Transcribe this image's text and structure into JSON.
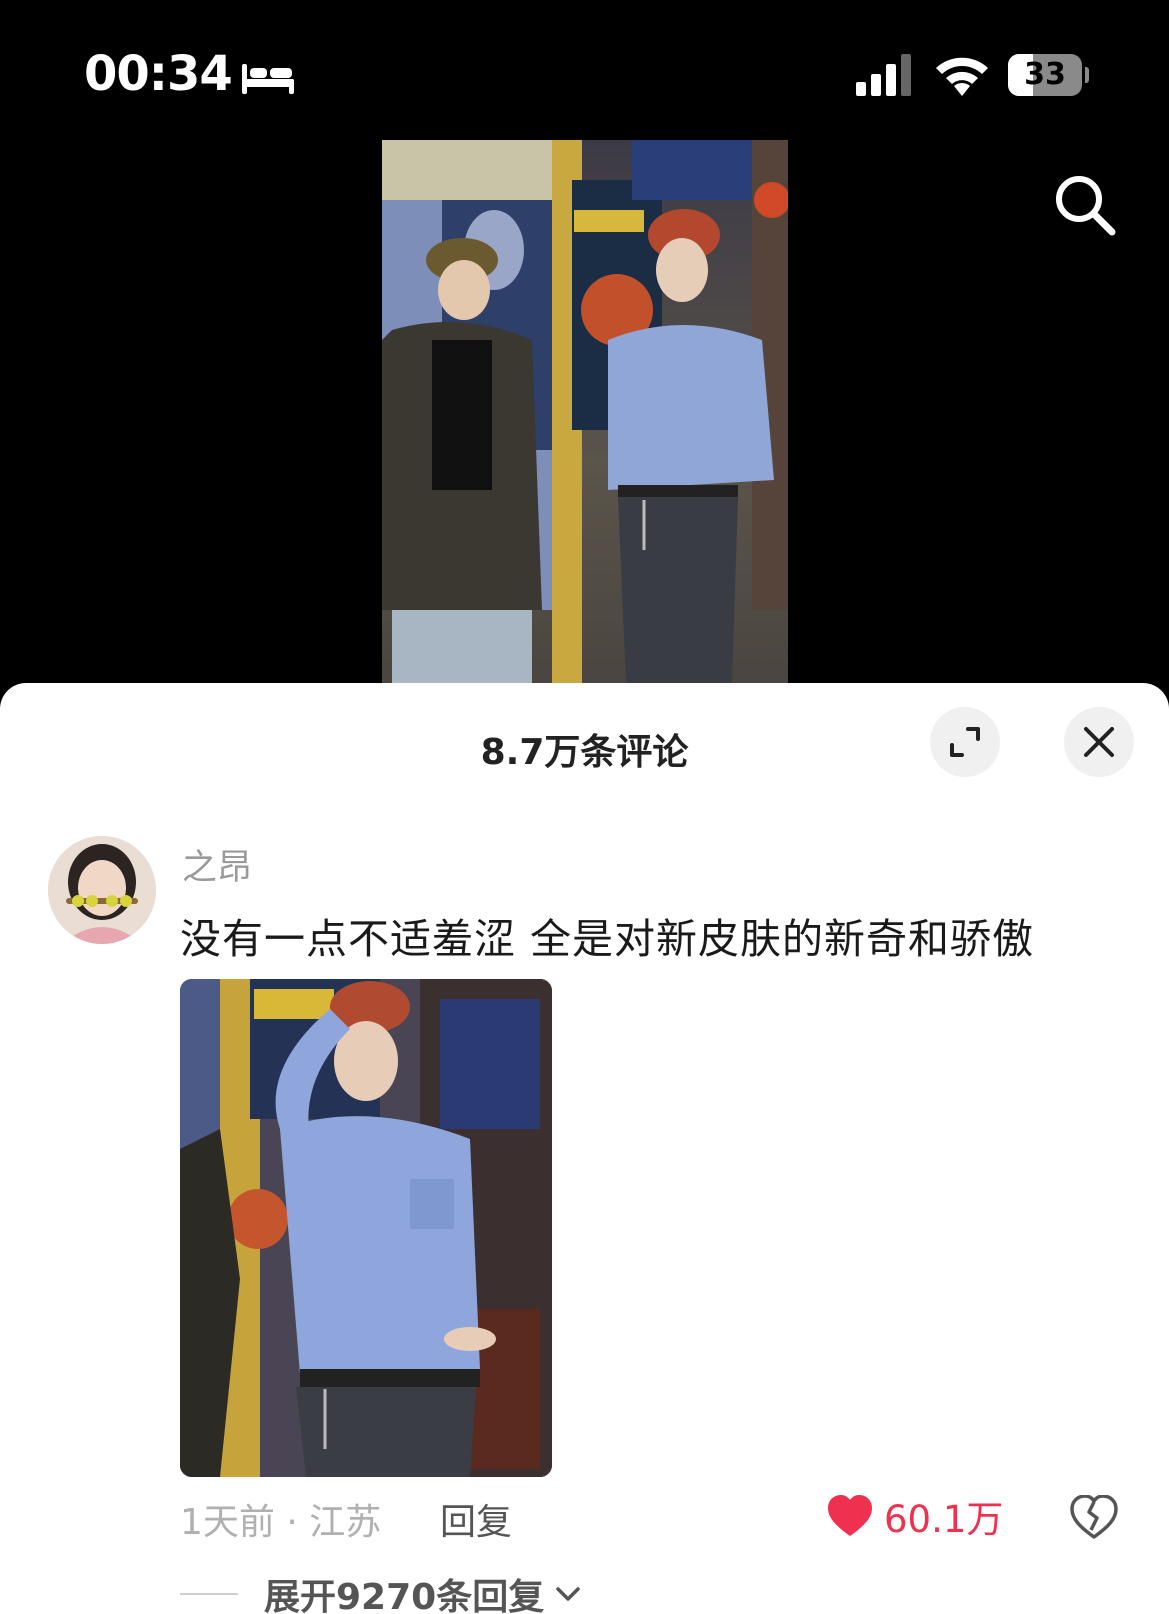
{
  "status_bar": {
    "time": "00:34",
    "battery_level": "33",
    "icons": [
      "bed-sleep-icon",
      "cellular-signal-icon",
      "wifi-icon",
      "battery-icon"
    ]
  },
  "video": {
    "icons": [
      "search-icon"
    ]
  },
  "comments_sheet": {
    "title": "8.7万条评论",
    "icons": [
      "expand-icon",
      "close-icon"
    ],
    "comment": {
      "username": "之昂",
      "text": "没有一点不适羞涩 全是对新皮肤的新奇和骄傲",
      "time_location": "1天前 · 江苏",
      "reply_label": "回复",
      "like_count": "60.1万",
      "like_color": "#f0304f",
      "expand_replies_label": "展开9270条回复"
    }
  }
}
